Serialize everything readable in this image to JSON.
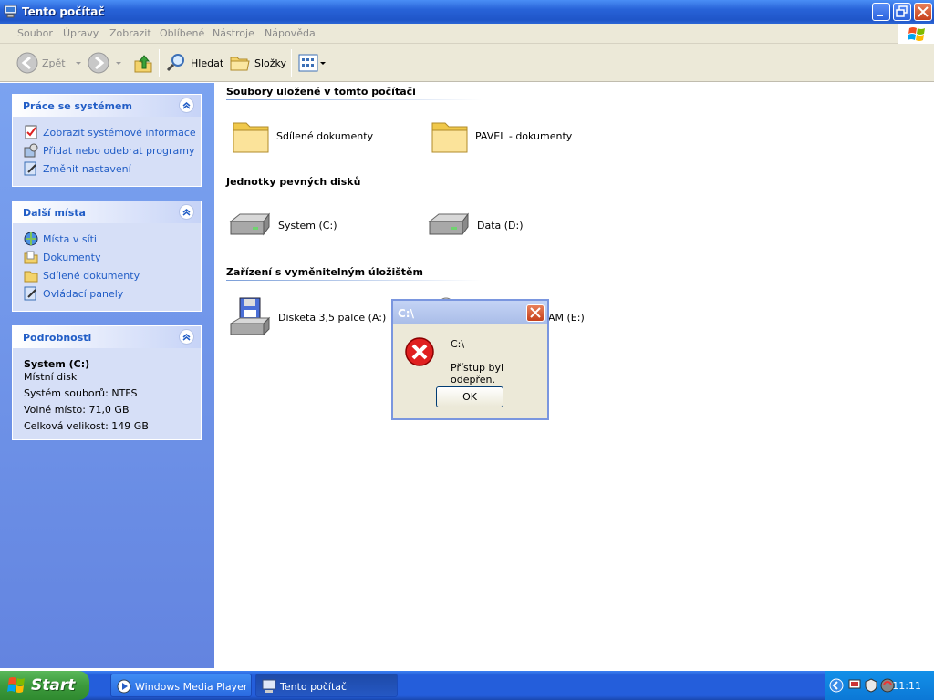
{
  "window": {
    "title": "Tento počítač"
  },
  "menu": {
    "items": [
      "Soubor",
      "Úpravy",
      "Zobrazit",
      "Oblíbené",
      "Nástroje",
      "Nápověda"
    ]
  },
  "toolbar": {
    "back_label": "Zpět",
    "search_label": "Hledat",
    "folders_label": "Složky"
  },
  "sidebar": {
    "system_tasks": {
      "title": "Práce se systémem",
      "links": [
        "Zobrazit systémové informace",
        "Přidat nebo odebrat programy",
        "Změnit nastavení"
      ]
    },
    "other_places": {
      "title": "Další místa",
      "links": [
        "Místa v síti",
        "Dokumenty",
        "Sdílené dokumenty",
        "Ovládací panely"
      ]
    },
    "details": {
      "title": "Podrobnosti",
      "name": "System (C:)",
      "type": "Místní disk",
      "filesystem": "Systém souborů: NTFS",
      "free": "Volné místo: 71,0 GB",
      "total": "Celková velikost: 149 GB"
    }
  },
  "main": {
    "sections": [
      {
        "title": "Soubory uložené v tomto počítači",
        "items": [
          "Sdílené dokumenty",
          "PAVEL - dokumenty"
        ]
      },
      {
        "title": "Jednotky pevných disků",
        "items": [
          "System (C:)",
          "Data (D:)"
        ]
      },
      {
        "title": "Zařízení s vyměnitelným úložištěm",
        "items": [
          "Disketa 3,5 palce (A:)",
          "AM (E:)"
        ]
      }
    ]
  },
  "dialog": {
    "title": "C:\\",
    "path": "C:\\",
    "message": "Přístup byl odepřen.",
    "ok_label": "OK"
  },
  "taskbar": {
    "start_label": "Start",
    "tasks": [
      "Windows Media Player",
      "Tento počítač"
    ],
    "clock": "11:11"
  }
}
